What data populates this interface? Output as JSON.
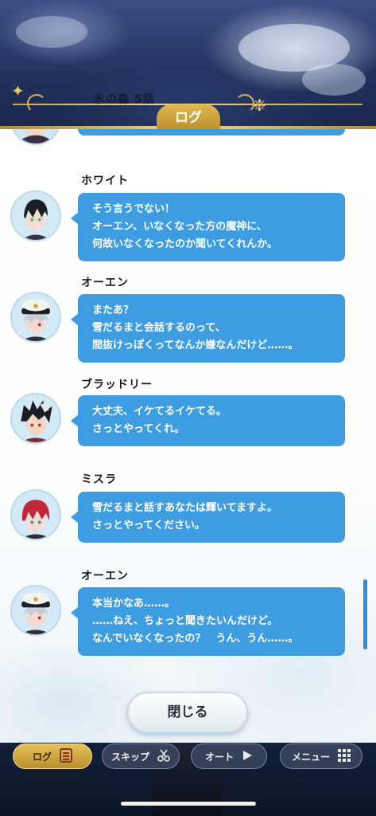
{
  "header": {
    "chapter_title": "氷の森 5話",
    "tab_label": "ログ"
  },
  "log": {
    "entries": [
      {
        "speaker": "ホワイト",
        "text": "そう言うでない！\nオーエン、いなくなった方の魔神に、\n何故いなくなったのか聞いてくれんか。"
      },
      {
        "speaker": "オーエン",
        "text": "またあ？\n雪だるまと会話するのって、\n間抜けっぽくってなんか嫌なんだけど……。"
      },
      {
        "speaker": "ブラッドリー",
        "text": "大丈夫、イケてるイケてる。\nさっとやってくれ。"
      },
      {
        "speaker": "ミスラ",
        "text": "雪だるまと話すあなたは輝いてますよ。\nさっとやってください。"
      },
      {
        "speaker": "オーエン",
        "text": "本当かなあ……。\n……ねえ、ちょっと聞きたいんだけど。\nなんでいなくなったの？　うん、うん……。"
      }
    ],
    "close_label": "閉じる"
  },
  "controls": {
    "log_label": "ログ",
    "skip_label": "スキップ",
    "auto_label": "オート",
    "menu_label": "メニュー",
    "accent_gold": "#d4ab45",
    "bubble_blue": "#3d9de0"
  }
}
